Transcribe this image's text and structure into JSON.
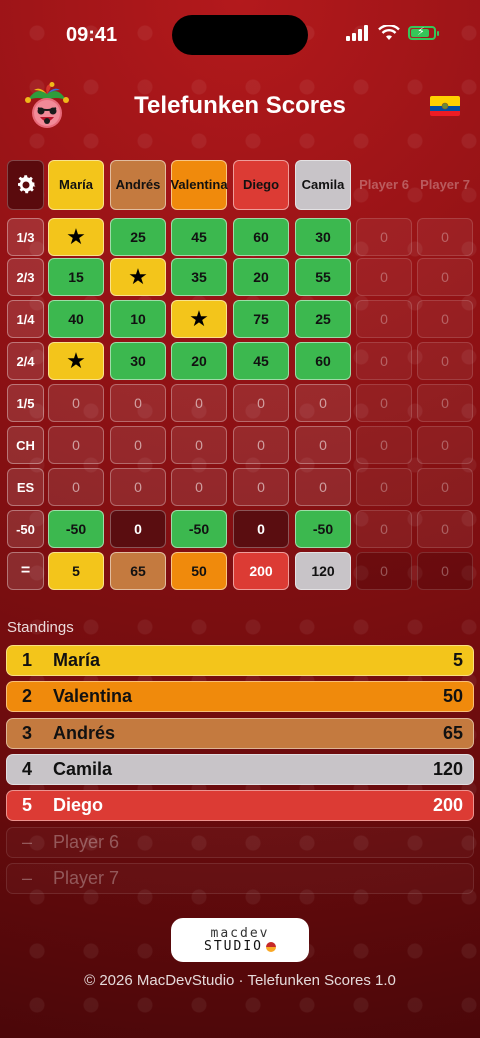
{
  "status": {
    "time": "09:41"
  },
  "header": {
    "title": "Telefunken Scores"
  },
  "columns": [
    "María",
    "Andrés",
    "Valentina",
    "Diego",
    "Camila",
    "Player 6",
    "Player 7"
  ],
  "column_colors": [
    "#f3c51b",
    "#c47a3f",
    "#f08a0c",
    "#dc3b34",
    "#c8c4c8",
    "",
    ""
  ],
  "rows": [
    {
      "label": "1/3",
      "cells": [
        "★",
        "25",
        "45",
        "60",
        "30",
        "0",
        "0"
      ],
      "kinds": [
        "star",
        "green",
        "green",
        "green",
        "green",
        "faint",
        "faint"
      ]
    },
    {
      "label": "2/3",
      "cells": [
        "15",
        "★",
        "35",
        "20",
        "55",
        "0",
        "0"
      ],
      "kinds": [
        "green",
        "star",
        "green",
        "green",
        "green",
        "faint",
        "faint"
      ]
    },
    {
      "label": "1/4",
      "cells": [
        "40",
        "10",
        "★",
        "75",
        "25",
        "0",
        "0"
      ],
      "kinds": [
        "green",
        "green",
        "star",
        "green",
        "green",
        "faint",
        "faint"
      ]
    },
    {
      "label": "2/4",
      "cells": [
        "★",
        "30",
        "20",
        "45",
        "60",
        "0",
        "0"
      ],
      "kinds": [
        "star",
        "green",
        "green",
        "green",
        "green",
        "faint",
        "faint"
      ]
    },
    {
      "label": "1/5",
      "cells": [
        "0",
        "0",
        "0",
        "0",
        "0",
        "0",
        "0"
      ],
      "kinds": [
        "empty",
        "empty",
        "empty",
        "empty",
        "empty",
        "faint",
        "faint"
      ]
    },
    {
      "label": "CH",
      "cells": [
        "0",
        "0",
        "0",
        "0",
        "0",
        "0",
        "0"
      ],
      "kinds": [
        "empty",
        "empty",
        "empty",
        "empty",
        "empty",
        "faint",
        "faint"
      ]
    },
    {
      "label": "ES",
      "cells": [
        "0",
        "0",
        "0",
        "0",
        "0",
        "0",
        "0"
      ],
      "kinds": [
        "empty",
        "empty",
        "empty",
        "empty",
        "empty",
        "faint",
        "faint"
      ]
    },
    {
      "label": "-50",
      "cells": [
        "-50",
        "0",
        "-50",
        "0",
        "-50",
        "0",
        "0"
      ],
      "kinds": [
        "green",
        "dark",
        "green",
        "dark",
        "green",
        "faint",
        "faint"
      ]
    }
  ],
  "totals": {
    "label": "=",
    "cells": [
      "5",
      "65",
      "50",
      "200",
      "120",
      "0",
      "0"
    ]
  },
  "standings": {
    "label": "Standings",
    "items": [
      {
        "rank": "1",
        "name": "María",
        "score": "5",
        "color": "#f3c51b"
      },
      {
        "rank": "2",
        "name": "Valentina",
        "score": "50",
        "color": "#f08a0c"
      },
      {
        "rank": "3",
        "name": "Andrés",
        "score": "65",
        "color": "#c47a3f"
      },
      {
        "rank": "4",
        "name": "Camila",
        "score": "120",
        "color": "#c8c4c8"
      },
      {
        "rank": "5",
        "name": "Diego",
        "score": "200",
        "color": "#dc3b34"
      },
      {
        "rank": "–",
        "name": "Player 6",
        "score": "",
        "color": ""
      },
      {
        "rank": "–",
        "name": "Player 7",
        "score": "",
        "color": ""
      }
    ]
  },
  "logo": {
    "line1": "macdev",
    "line2": "STUDIO"
  },
  "footer": {
    "text": "© 2026 MacDevStudio · Telefunken Scores 1.0"
  },
  "icons": {
    "settings": "gear-icon",
    "app": "jester-icon",
    "language": "ecuador-flag-icon"
  }
}
